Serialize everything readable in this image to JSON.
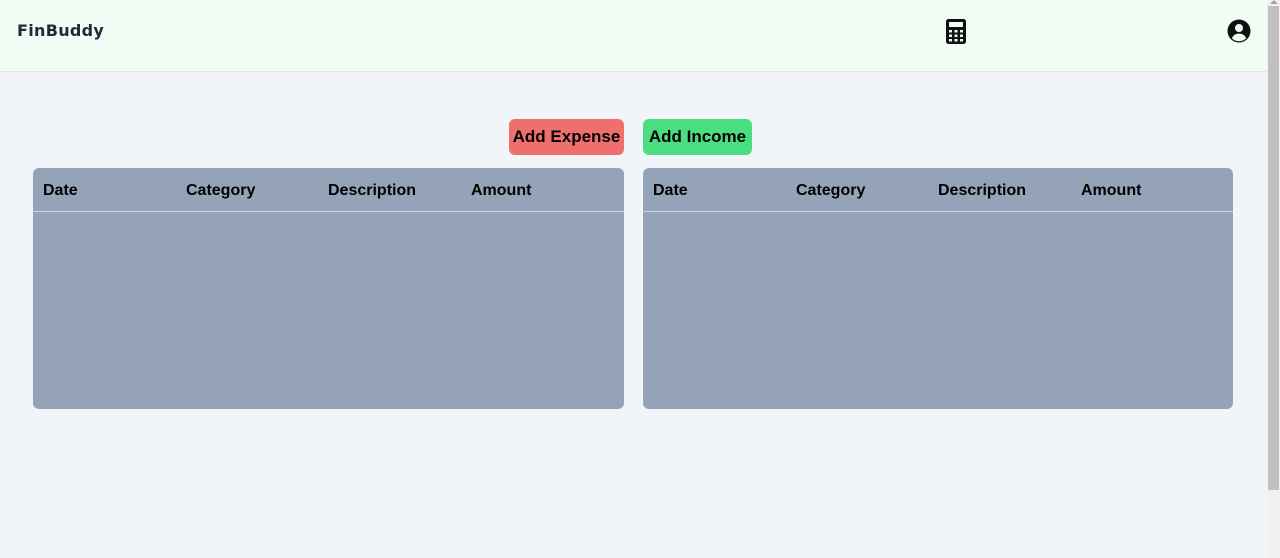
{
  "app": {
    "brand": "FinBuddy"
  },
  "header": {
    "calculator_icon": "calculator-icon",
    "user_icon": "user-circle-icon"
  },
  "actions": {
    "add_expense_label": "Add Expense",
    "add_income_label": "Add Income",
    "expense_color": "#ef6f6c",
    "income_color": "#4ade80"
  },
  "expense_table": {
    "columns": [
      "Date",
      "Category",
      "Description",
      "Amount"
    ],
    "rows": []
  },
  "income_table": {
    "columns": [
      "Date",
      "Category",
      "Description",
      "Amount"
    ],
    "rows": []
  },
  "colors": {
    "header_bg": "#effdf4",
    "page_bg": "#f1f5f9",
    "table_bg": "#94a3b8"
  }
}
